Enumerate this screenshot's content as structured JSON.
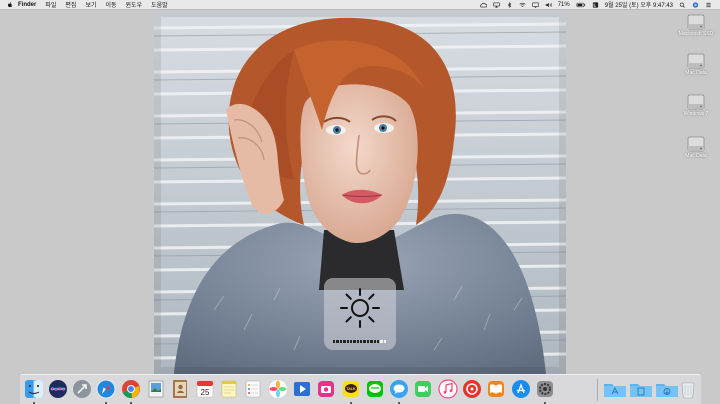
{
  "menubar": {
    "app_name": "Finder",
    "items": [
      "파일",
      "편집",
      "보기",
      "이동",
      "윈도우",
      "도움말"
    ],
    "battery_percent": "71%",
    "datetime": "9월 25일 (토) 오후 9:47:43",
    "icons": [
      "apple-icon",
      "wifi-icon",
      "bluetooth-icon",
      "volume-icon",
      "battery-icon",
      "spotlight-icon",
      "notification-icon"
    ]
  },
  "hud": {
    "type": "brightness",
    "icon": "sun-icon",
    "level_fraction": 0.88
  },
  "desktop": {
    "drives": [
      {
        "label": "Macintosh SSD"
      },
      {
        "label": "Mac Data"
      },
      {
        "label": "Windows 7"
      },
      {
        "label": "Mac Data"
      }
    ]
  },
  "dock": {
    "calendar_day": "25",
    "chat_label": "TALK",
    "apps": [
      "finder",
      "siri",
      "launchpad",
      "safari",
      "chrome",
      "preview",
      "contacts",
      "calendar",
      "notes",
      "reminders",
      "photos",
      "keynote",
      "camera",
      "kakaotalk",
      "line",
      "messages",
      "facetime",
      "itunes",
      "music-player",
      "ibooks",
      "app-store",
      "system-preferences"
    ],
    "folders": [
      "applications-folder",
      "documents-folder",
      "downloads-folder",
      "trash"
    ]
  },
  "colors": {
    "menubar": "#e9e9e9",
    "desktop": "#c9c9c9",
    "hair": "#b4572b",
    "coat": "#7f8ea3"
  }
}
